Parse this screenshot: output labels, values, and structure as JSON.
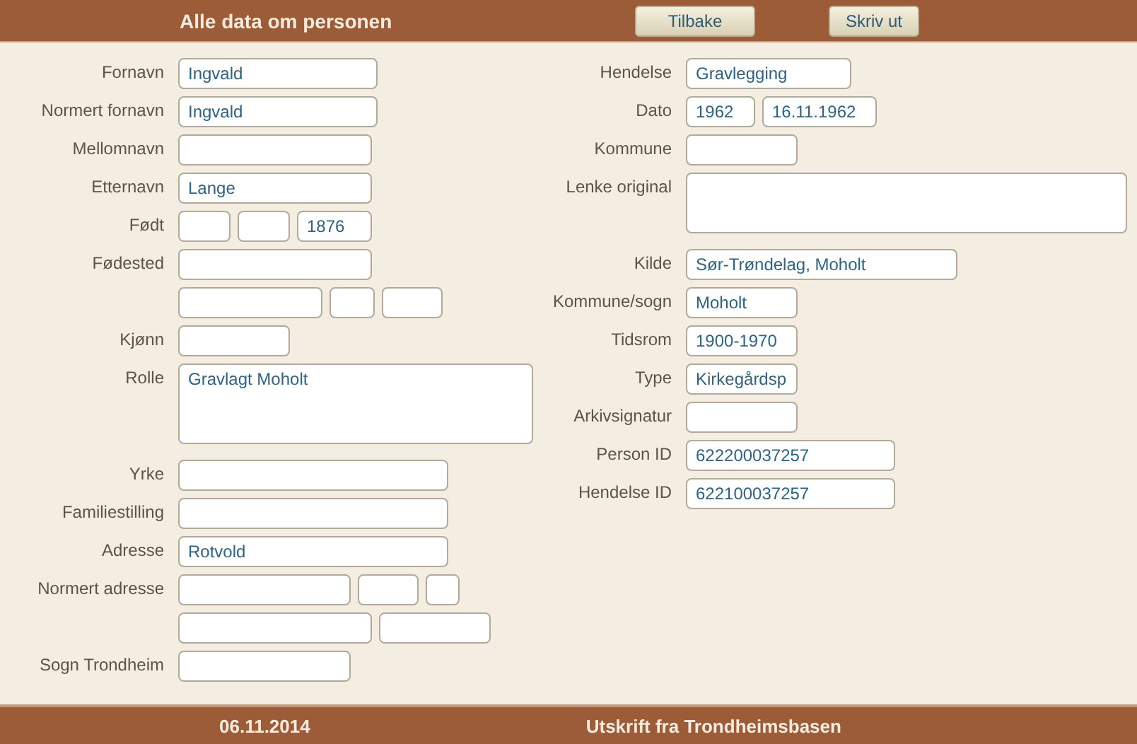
{
  "header": {
    "title": "Alle data om personen",
    "buttons": [
      "Tilbake",
      "Skriv ut"
    ]
  },
  "left": [
    {
      "label": "Fornavn",
      "fields": [
        {
          "kind": "text",
          "value": "Ingvald"
        }
      ]
    },
    {
      "label": "Normert fornavn",
      "fields": [
        {
          "kind": "text",
          "value": "Ingvald"
        }
      ]
    },
    {
      "label": "Mellomnavn",
      "fields": [
        {
          "kind": "text"
        }
      ]
    },
    {
      "label": "Etternavn",
      "fields": [
        {
          "kind": "text",
          "value": "Lange"
        }
      ]
    },
    {
      "label": "Født",
      "fields": [
        {
          "kind": "text"
        },
        {
          "kind": "text"
        },
        {
          "kind": "text",
          "value": "1876"
        }
      ]
    },
    {
      "label": "Fødested",
      "fields": [
        {
          "kind": "text"
        }
      ]
    },
    {
      "fields": [
        {
          "kind": "text"
        },
        {
          "kind": "text"
        },
        {
          "kind": "text"
        }
      ]
    },
    {
      "label": "Kjønn",
      "fields": [
        {
          "kind": "text"
        }
      ]
    },
    {
      "label": "Rolle",
      "fields": [
        {
          "kind": "area",
          "value": "Gravlagt Moholt"
        }
      ]
    },
    {
      "label": "Yrke",
      "fields": [
        {
          "kind": "text"
        }
      ]
    },
    {
      "label": "Familiestilling",
      "fields": [
        {
          "kind": "text"
        }
      ]
    },
    {
      "label": "Adresse",
      "fields": [
        {
          "kind": "text",
          "value": "Rotvold"
        }
      ]
    },
    {
      "label": "Normert adresse",
      "fields": [
        {
          "kind": "text"
        },
        {
          "kind": "text"
        },
        {
          "kind": "text"
        }
      ]
    },
    {
      "fields": [
        {
          "kind": "text"
        },
        {
          "kind": "text"
        }
      ]
    },
    {
      "label": "Sogn Trondheim",
      "fields": [
        {
          "kind": "text"
        }
      ]
    }
  ],
  "right": [
    {
      "label": "Hendelse",
      "fields": [
        {
          "kind": "text",
          "value": "Gravlegging"
        }
      ]
    },
    {
      "label": "Dato",
      "fields": [
        {
          "kind": "text",
          "value": "1962"
        },
        {
          "kind": "text",
          "value": "16.11.1962"
        }
      ]
    },
    {
      "label": "Kommune",
      "fields": [
        {
          "kind": "text"
        }
      ]
    },
    {
      "label": "Lenke original",
      "fields": [
        {
          "kind": "area"
        }
      ]
    },
    {
      "label": "Kilde",
      "fields": [
        {
          "kind": "text",
          "value": "Sør-Trøndelag, Moholt"
        }
      ]
    },
    {
      "label": "Kommune/sogn",
      "fields": [
        {
          "kind": "text",
          "value": "Moholt"
        }
      ]
    },
    {
      "label": "Tidsrom",
      "fields": [
        {
          "kind": "text",
          "value": "1900-1970"
        }
      ]
    },
    {
      "label": "Type",
      "fields": [
        {
          "kind": "text",
          "value": "Kirkegårdsp"
        }
      ]
    },
    {
      "label": "Arkivsignatur",
      "fields": [
        {
          "kind": "text"
        }
      ]
    },
    {
      "label": "Person ID",
      "fields": [
        {
          "kind": "text",
          "value": "622200037257"
        }
      ]
    },
    {
      "label": "Hendelse ID",
      "fields": [
        {
          "kind": "text",
          "value": "622100037257"
        }
      ]
    }
  ],
  "footer": {
    "date": "06.11.2014",
    "source": "Utskrift fra Trondheimsbasen"
  }
}
